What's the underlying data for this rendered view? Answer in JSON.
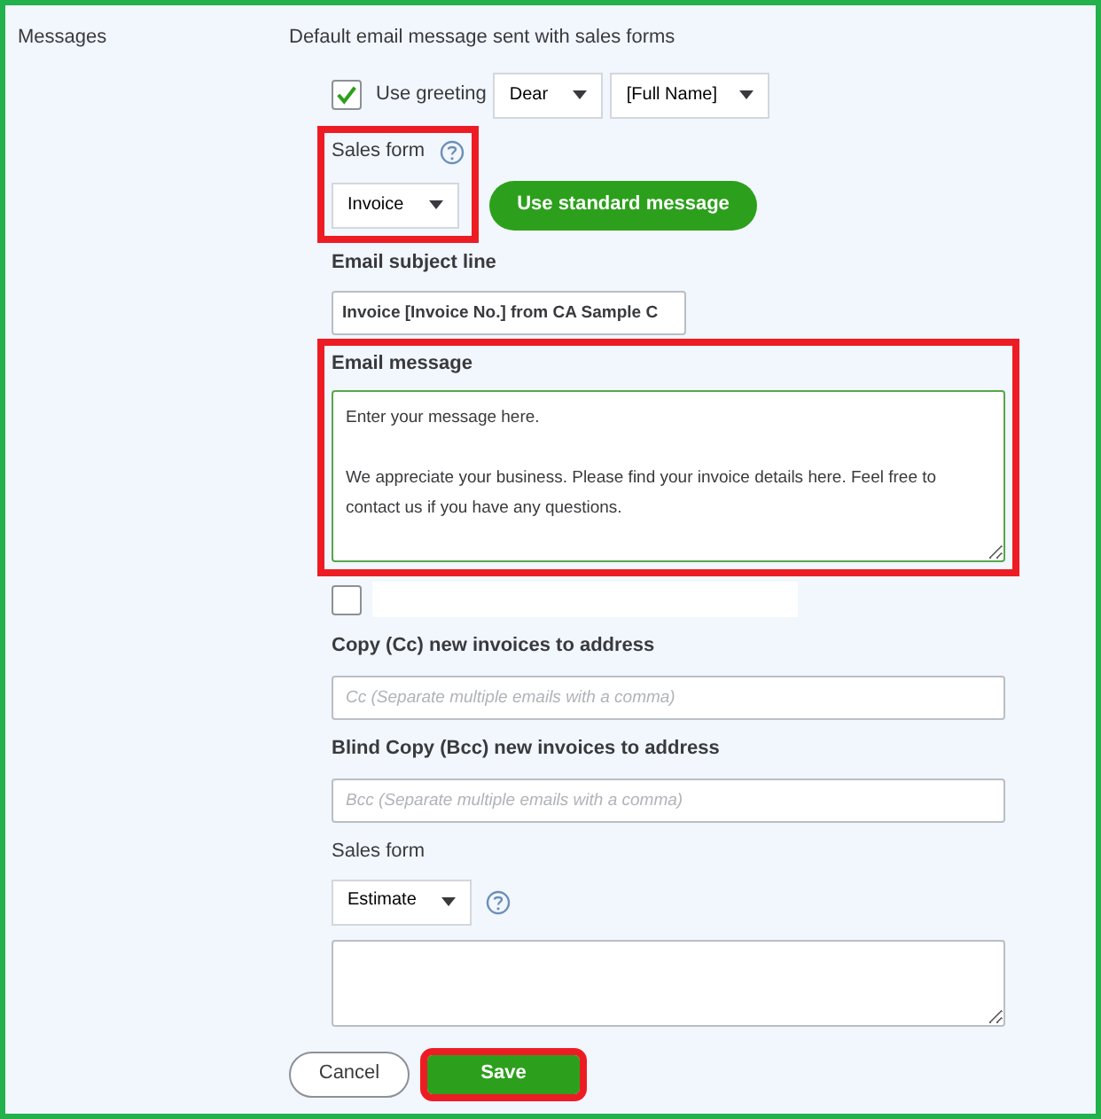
{
  "section_label": "Messages",
  "heading": "Default email message sent with sales forms",
  "greeting": {
    "checked": true,
    "label": "Use greeting",
    "salutation": "Dear",
    "name_format": "[Full Name]"
  },
  "sales_form": {
    "label": "Sales form",
    "value": "Invoice",
    "highlighted": true
  },
  "standard_button": "Use standard message",
  "subject": {
    "label": "Email subject line",
    "value": "Invoice [Invoice No.] from CA Sample C"
  },
  "message": {
    "label": "Email message",
    "value": "Enter your message here.\n\nWe appreciate your business. Please find your invoice details here. Feel free to contact us if you have any questions.",
    "highlighted": true
  },
  "copy_checkbox": {
    "checked": false
  },
  "cc": {
    "label": "Copy (Cc) new invoices to address",
    "placeholder": "Cc (Separate multiple emails with a comma)"
  },
  "bcc": {
    "label": "Blind Copy (Bcc) new invoices to address",
    "placeholder": "Bcc (Separate multiple emails with a comma)"
  },
  "sales_form_2": {
    "label": "Sales form",
    "value": "Estimate"
  },
  "buttons": [
    {
      "label": "Cancel",
      "kind": "secondary",
      "highlighted": false
    },
    {
      "label": "Save",
      "kind": "primary",
      "highlighted": true
    }
  ]
}
